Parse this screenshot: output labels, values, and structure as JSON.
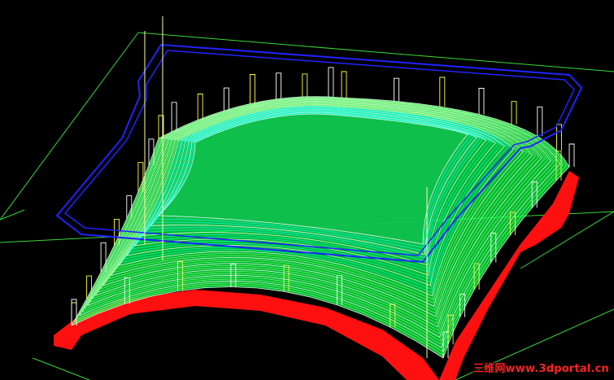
{
  "viewport": {
    "background": "#000000",
    "colors": {
      "grid": "#38d838",
      "boundary": "#2222ff",
      "toolpath": "#00ff40",
      "toolpath_highlight": "#00ffd8",
      "stock_side": "#ff1010",
      "plunge": "#ffff40"
    }
  },
  "watermark": {
    "text": "三维网www.3dportal.cn",
    "color": "#ff2020"
  }
}
